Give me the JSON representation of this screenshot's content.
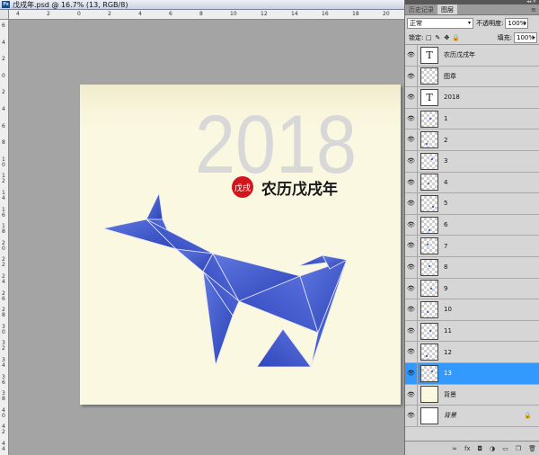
{
  "document": {
    "title": "戊戌年.psd @ 16.7% (13, RGB/8)",
    "ps_logo": "Ps",
    "artwork": {
      "year": "2018",
      "seal_text": "戊戌",
      "caption": "农历戊戌年",
      "year_color": "#d8d8d8",
      "seal_color": "#d4141c",
      "dog_color": "#3b55c9",
      "canvas_color": "#fbf8e1"
    }
  },
  "rulers": {
    "horizontal": [
      "4",
      "2",
      "0",
      "2",
      "4",
      "6",
      "8",
      "10",
      "12",
      "14",
      "16",
      "18",
      "20"
    ],
    "vertical": [
      "6",
      "4",
      "2",
      "0",
      "2",
      "4",
      "6",
      "8",
      "1\n0",
      "1\n2",
      "1\n4",
      "1\n6",
      "1\n8",
      "2\n0",
      "2\n2",
      "2\n4",
      "2\n6",
      "2\n8",
      "3\n0",
      "3\n2",
      "3\n4",
      "3\n6",
      "3\n8",
      "4\n0",
      "4\n2",
      "4\n4"
    ]
  },
  "panel": {
    "collapse_glyph": "◂◂ ✕",
    "tabs": [
      {
        "label": "历史记录",
        "active": false
      },
      {
        "label": "图层",
        "active": true
      }
    ],
    "menu_icon": "≡",
    "blend_mode": "正常",
    "opacity_label": "不透明度:",
    "opacity_value": "100%",
    "lock_label": "锁定:",
    "fill_label": "填充:",
    "fill_value": "100%",
    "layers": [
      {
        "name": "农历戊戌年",
        "thumb": "text",
        "selected": false
      },
      {
        "name": "图章",
        "thumb": "transparent",
        "selected": false
      },
      {
        "name": "2018",
        "thumb": "text",
        "selected": false
      },
      {
        "name": "1",
        "thumb": "transparent",
        "selected": false
      },
      {
        "name": "2",
        "thumb": "transparent",
        "selected": false
      },
      {
        "name": "3",
        "thumb": "transparent",
        "selected": false
      },
      {
        "name": "4",
        "thumb": "transparent",
        "selected": false
      },
      {
        "name": "5",
        "thumb": "transparent",
        "selected": false
      },
      {
        "name": "6",
        "thumb": "transparent",
        "selected": false
      },
      {
        "name": "7",
        "thumb": "transparent",
        "selected": false
      },
      {
        "name": "8",
        "thumb": "transparent",
        "selected": false
      },
      {
        "name": "9",
        "thumb": "transparent",
        "selected": false
      },
      {
        "name": "10",
        "thumb": "transparent",
        "selected": false
      },
      {
        "name": "11",
        "thumb": "transparent",
        "selected": false
      },
      {
        "name": "12",
        "thumb": "transparent",
        "selected": false
      },
      {
        "name": "13",
        "thumb": "transparent",
        "selected": true
      },
      {
        "name": "背景",
        "thumb": "background",
        "selected": false
      },
      {
        "name": "背景",
        "thumb": "white",
        "selected": false,
        "italic": true,
        "locked": true
      }
    ],
    "footer_icons": [
      "link-icon",
      "fx-icon",
      "mask-icon",
      "adjustment-icon",
      "group-icon",
      "new-layer-icon",
      "trash-icon"
    ],
    "footer_glyphs": [
      "∞",
      "fx",
      "◘",
      "◑",
      "▭",
      "❐",
      "🗑"
    ]
  }
}
